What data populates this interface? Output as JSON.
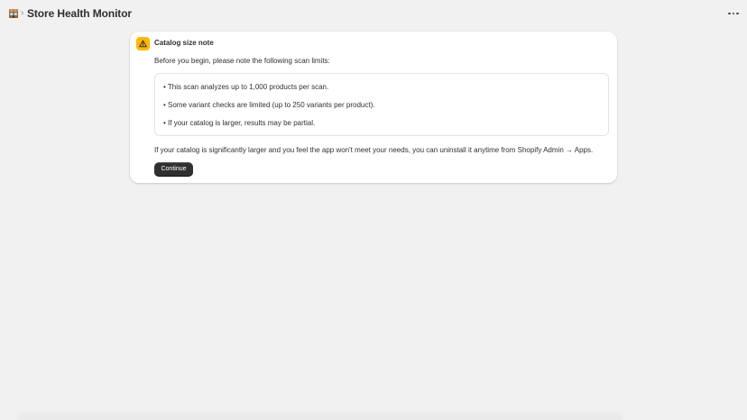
{
  "header": {
    "breadcrumb_separator": "›",
    "app_title": "Store Health Monitor",
    "app_icon": "storefront-icon",
    "more_actions_icon": "ellipsis-icon"
  },
  "notice": {
    "icon": "warning-icon",
    "accent_color": "#ffb800",
    "title": "Catalog size note",
    "intro": "Before you begin, please note the following scan limits:",
    "limits": [
      "• This scan analyzes up to 1,000 products per scan.",
      "• Some variant checks are limited (up to 250 variants per product).",
      "• If your catalog is larger, results may be partial."
    ],
    "uninstall_note": "If your catalog is significantly larger and you feel the app won't meet your needs, you can uninstall it anytime from Shopify Admin → Apps.",
    "continue_label": "Continue"
  }
}
